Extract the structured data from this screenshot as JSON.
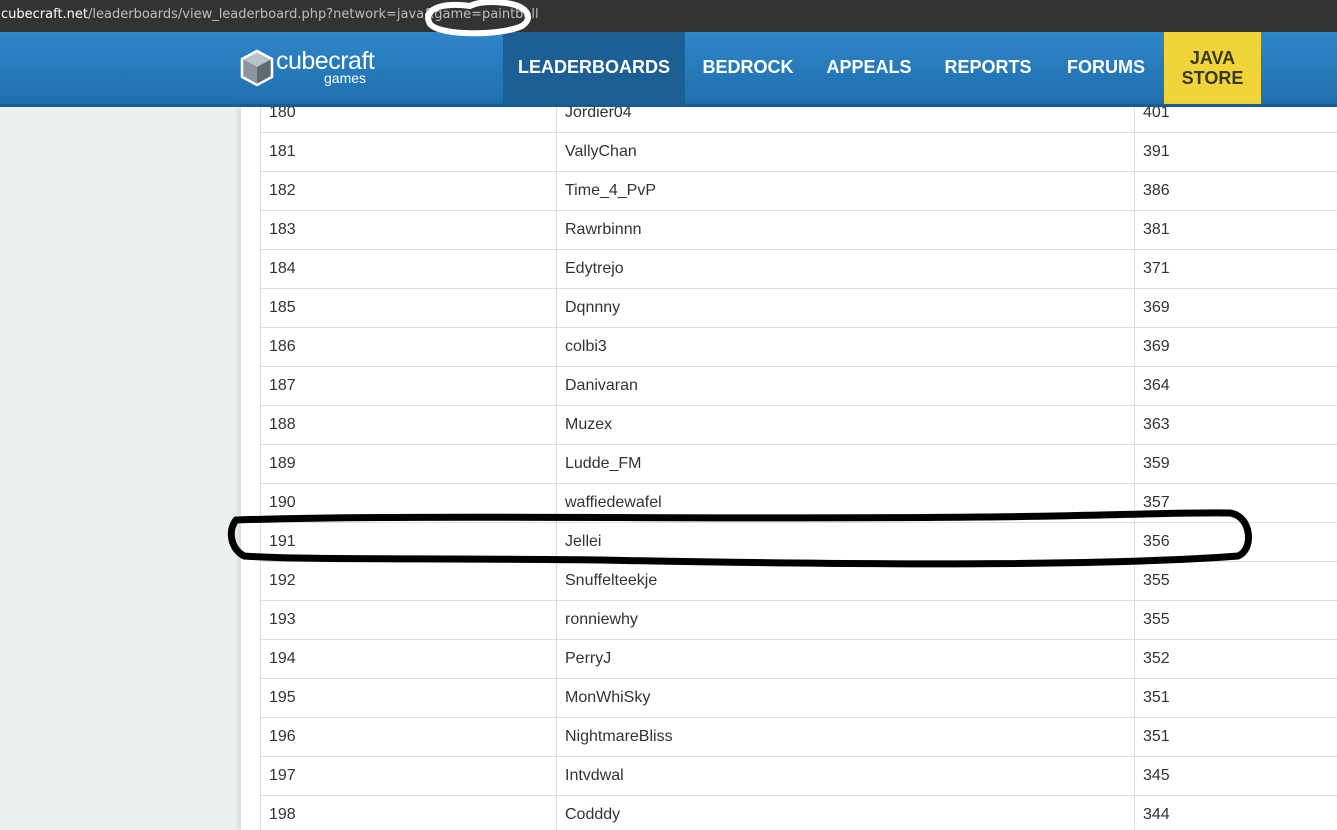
{
  "browser": {
    "url_host": "cubecraft.net",
    "url_path": "/leaderboards/view_leaderboard.php?network=java&game=paintball"
  },
  "brand": {
    "name": "cubecraft",
    "sub": "games"
  },
  "nav": {
    "leaderboards": "LEADERBOARDS",
    "bedrock": "BEDROCK",
    "appeals": "APPEALS",
    "reports": "REPORTS",
    "forums": "FORUMS",
    "store_line1": "JAVA",
    "store_line2": "STORE"
  },
  "leaderboard": {
    "rows": [
      {
        "rank": "180",
        "name": "Jordier04",
        "score": "401"
      },
      {
        "rank": "181",
        "name": "VallyChan",
        "score": "391"
      },
      {
        "rank": "182",
        "name": "Time_4_PvP",
        "score": "386"
      },
      {
        "rank": "183",
        "name": "Rawrbinnn",
        "score": "381"
      },
      {
        "rank": "184",
        "name": "Edytrejo",
        "score": "371"
      },
      {
        "rank": "185",
        "name": "Dqnnny",
        "score": "369"
      },
      {
        "rank": "186",
        "name": "colbi3",
        "score": "369"
      },
      {
        "rank": "187",
        "name": "Danivaran",
        "score": "364"
      },
      {
        "rank": "188",
        "name": "Muzex",
        "score": "363"
      },
      {
        "rank": "189",
        "name": "Ludde_FM",
        "score": "359"
      },
      {
        "rank": "190",
        "name": "waffiedewafel",
        "score": "357"
      },
      {
        "rank": "191",
        "name": "Jellei",
        "score": "356"
      },
      {
        "rank": "192",
        "name": "Snuffelteekje",
        "score": "355"
      },
      {
        "rank": "193",
        "name": "ronniewhy",
        "score": "355"
      },
      {
        "rank": "194",
        "name": "PerryJ",
        "score": "352"
      },
      {
        "rank": "195",
        "name": "MonWhiSky",
        "score": "351"
      },
      {
        "rank": "196",
        "name": "NightmareBliss",
        "score": "351"
      },
      {
        "rank": "197",
        "name": "Intvdwal",
        "score": "345"
      },
      {
        "rank": "198",
        "name": "Codddy",
        "score": "344"
      }
    ]
  },
  "colors": {
    "nav_blue": "#2f86c8",
    "nav_active": "#1c5f94",
    "store_yellow": "#f0d43a",
    "annotation": "#000000"
  }
}
